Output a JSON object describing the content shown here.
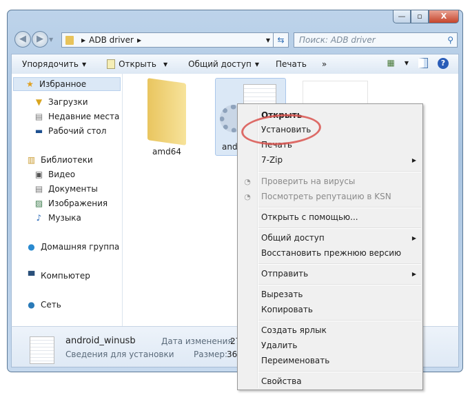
{
  "window": {
    "controls": {
      "minimize": "—",
      "maximize": "▫",
      "close": "X"
    }
  },
  "address": {
    "crumb": "ADB driver"
  },
  "search": {
    "placeholder": "Поиск: ADB driver"
  },
  "toolbar": {
    "organize": "Упорядочить",
    "open": "Открыть",
    "share": "Общий доступ",
    "print": "Печать",
    "more": "»"
  },
  "sidebar": {
    "favorites": "Избранное",
    "fav_items": [
      "Загрузки",
      "Недавние места",
      "Рабочий стол"
    ],
    "libraries": "Библиотеки",
    "lib_items": [
      "Видео",
      "Документы",
      "Изображения",
      "Музыка"
    ],
    "homegroup": "Домашняя группа",
    "computer": "Компьютер",
    "network": "Сеть"
  },
  "files": [
    {
      "name": "amd64"
    },
    {
      "name": "andr"
    }
  ],
  "status": {
    "name": "android_winusb",
    "type": "Сведения для установки",
    "date_label": "Дата изменения:",
    "date_value": "27.",
    "size_label": "Размер:",
    "size_value": "366"
  },
  "context_menu": {
    "items": [
      {
        "label": "Открыть",
        "bold": true
      },
      {
        "label": "Установить"
      },
      {
        "label": "Печать"
      },
      {
        "label": "7-Zip",
        "submenu": true
      },
      {
        "label": "Проверить на вирусы",
        "disabled": true
      },
      {
        "label": "Посмотреть репутацию в KSN",
        "disabled": true
      },
      {
        "label": "Открыть с помощью..."
      },
      {
        "label": "Общий доступ",
        "submenu": true
      },
      {
        "label": "Восстановить прежнюю версию"
      },
      {
        "label": "Отправить",
        "submenu": true
      },
      {
        "label": "Вырезать"
      },
      {
        "label": "Копировать"
      },
      {
        "label": "Создать ярлык"
      },
      {
        "label": "Удалить"
      },
      {
        "label": "Переименовать"
      },
      {
        "label": "Свойства"
      }
    ]
  },
  "colors": {
    "highlight": "#d9534f",
    "selection": "#dbe8f6"
  }
}
